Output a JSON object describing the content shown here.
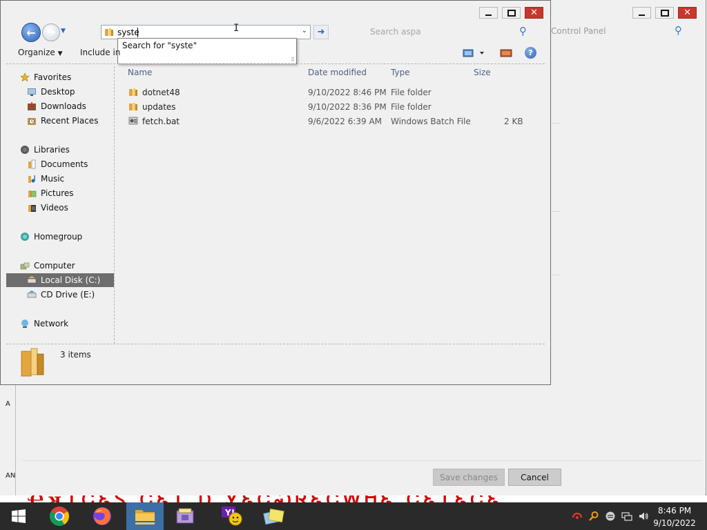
{
  "background_window": {
    "search_placeholder": "Control Panel",
    "buttons": {
      "save_changes": "Save changes",
      "cancel": "Cancel"
    },
    "desktop_icon_labels": [
      "A",
      "AN"
    ]
  },
  "front_window": {
    "address_bar": {
      "value": "syste"
    },
    "autocomplete": {
      "suggestion": "Search for \"syste\""
    },
    "search_placeholder": "Search aspa",
    "toolbar": {
      "organize": "Organize",
      "include_in": "Include in"
    },
    "nav_pane": {
      "favorites": {
        "label": "Favorites",
        "items": [
          "Desktop",
          "Downloads",
          "Recent Places"
        ]
      },
      "libraries": {
        "label": "Libraries",
        "items": [
          "Documents",
          "Music",
          "Pictures",
          "Videos"
        ]
      },
      "homegroup": {
        "label": "Homegroup"
      },
      "computer": {
        "label": "Computer",
        "items": [
          "Local Disk (C:)",
          "CD Drive (E:)"
        ],
        "selected": "Local Disk (C:)"
      },
      "network": {
        "label": "Network"
      }
    },
    "file_list": {
      "columns": [
        "Name",
        "Date modified",
        "Type",
        "Size"
      ],
      "rows": [
        {
          "name": "dotnet48",
          "date": "9/10/2022 8:46 PM",
          "type": "File folder",
          "size": "",
          "icon": "folder-icon"
        },
        {
          "name": "updates",
          "date": "9/10/2022 8:36 PM",
          "type": "File folder",
          "size": "",
          "icon": "folder-icon"
        },
        {
          "name": "fetch.bat",
          "date": "9/6/2022 6:39 AM",
          "type": "Windows Batch File",
          "size": "2 KB",
          "icon": "batch-file-icon"
        }
      ]
    },
    "details_pane": {
      "item_count": "3 items"
    }
  },
  "taskbar": {
    "apps": [
      "start-icon",
      "chrome-icon",
      "firefox-icon",
      "file-explorer-icon",
      "archive-app-icon",
      "yahoo-icon",
      "notes-app-icon"
    ],
    "active_app": "file-explorer-icon",
    "tray_icons": [
      "antivirus-icon",
      "search-tool-icon",
      "tray-app-icon",
      "network-icon",
      "volume-icon"
    ],
    "clock": {
      "time": "8:46 PM",
      "date": "9/10/2022"
    }
  },
  "colors": {
    "window_bg": "#f0f0f0",
    "close_button": "#c7372b",
    "selection": "#6d6d6d",
    "taskbar": "#2a2a2a",
    "active_taskbar_item": "#3d6fa5",
    "link_blue": "#2d64b8"
  }
}
